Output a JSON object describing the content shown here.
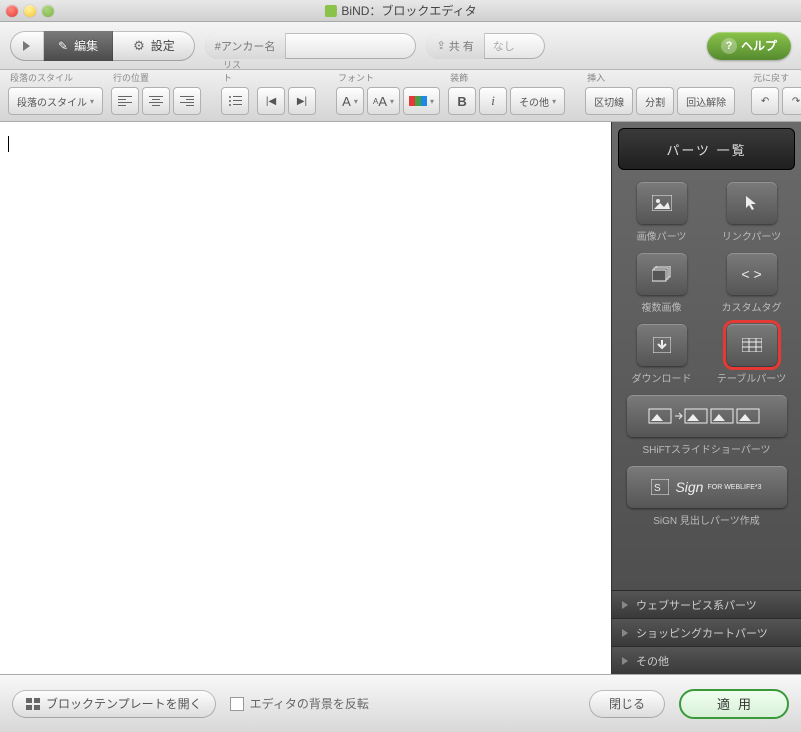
{
  "window": {
    "title": "BiND：ブロックエディタ"
  },
  "toolbar1": {
    "edit": "編集",
    "settings": "設定",
    "anchor_label": "#アンカー名",
    "anchor_value": "",
    "share_label": "共 有",
    "share_value": "なし",
    "help": "ヘルプ"
  },
  "toolbar2": {
    "groups": {
      "paragraph": "段落のスタイル",
      "align": "行の位置",
      "list": "リスト",
      "font": "フォント",
      "decoration": "装飾",
      "insert": "挿入",
      "undo": "元に戻す"
    },
    "paragraph_style": "段落のスタイル",
    "other": "その他",
    "insert_buttons": {
      "separator": "区切線",
      "split": "分割",
      "unwrap": "回込解除"
    }
  },
  "editor": {
    "content": ""
  },
  "side": {
    "header": "パーツ 一覧",
    "parts": {
      "image": "画像パーツ",
      "link": "リンクパーツ",
      "multi_image": "複数画像",
      "custom_tag": "カスタムタグ",
      "download": "ダウンロード",
      "table": "テーブルパーツ",
      "slideshow": "SHiFTスライドショーパーツ",
      "sign_main": "Sign",
      "sign_sub": "FOR WEBLIFE*3",
      "sign_label": "SiGN 見出しパーツ作成"
    },
    "accordion": {
      "web_service": "ウェブサービス系パーツ",
      "cart": "ショッピングカートパーツ",
      "other": "その他"
    }
  },
  "footer": {
    "template": "ブロックテンプレートを開く",
    "invert_bg": "エディタの背景を反転",
    "close": "閉じる",
    "apply": "適用"
  }
}
